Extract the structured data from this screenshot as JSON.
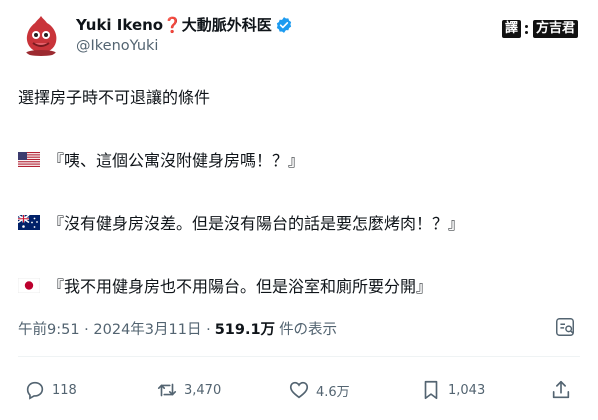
{
  "user": {
    "display_name": "Yuki Ikeno❓大動脈外科医",
    "handle": "@IkenoYuki"
  },
  "watermark": {
    "part1": "譯",
    "part2": "方吉君"
  },
  "tweet": {
    "title": "選擇房子時不可退讓的條件",
    "lines": [
      {
        "flag": "us-flag",
        "text": "『咦、這個公寓沒附健身房嗎！？』"
      },
      {
        "flag": "au-flag",
        "text": "『沒有健身房沒差。但是沒有陽台的話是要怎麼烤肉！？』"
      },
      {
        "flag": "jp-flag",
        "text": "『我不用健身房也不用陽台。但是浴室和廁所要分開』"
      }
    ]
  },
  "meta": {
    "timestamp": "午前9:51 · 2024年3月11日 ·",
    "views_count": "519.1万",
    "views_label": "件の表示"
  },
  "actions": {
    "replies": "118",
    "reposts": "3,470",
    "likes": "4.6万",
    "bookmarks": "1,043"
  },
  "colors": {
    "text": "#0f1419",
    "secondary": "#536471",
    "verified": "#1d9bf0"
  }
}
